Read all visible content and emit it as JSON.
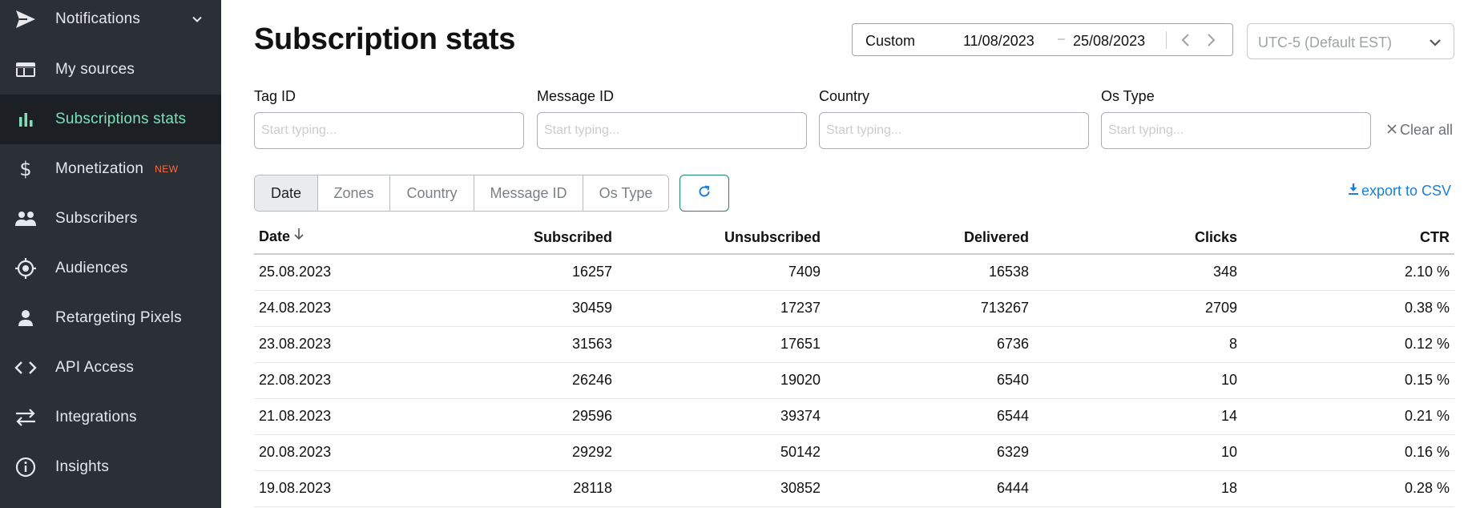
{
  "sidebar": {
    "items": [
      {
        "label": "Notifications",
        "icon": "send-icon",
        "has_chevron": true
      },
      {
        "label": "My sources",
        "icon": "sources-icon"
      },
      {
        "label": "Subscriptions stats",
        "icon": "bar-chart-icon",
        "active": true
      },
      {
        "label": "Monetization",
        "icon": "dollar-icon",
        "badge": "NEW"
      },
      {
        "label": "Subscribers",
        "icon": "people-icon"
      },
      {
        "label": "Audiences",
        "icon": "target-icon"
      },
      {
        "label": "Retargeting Pixels",
        "icon": "person-icon"
      },
      {
        "label": "API Access",
        "icon": "code-icon"
      },
      {
        "label": "Integrations",
        "icon": "swap-arrows-icon"
      },
      {
        "label": "Insights",
        "icon": "info-icon"
      }
    ]
  },
  "header": {
    "title": "Subscription stats",
    "date_range": {
      "preset": "Custom",
      "from": "11/08/2023",
      "dash": "–",
      "to": "25/08/2023"
    },
    "timezone": "UTC-5 (Default EST)"
  },
  "filters": {
    "fields": [
      {
        "label": "Tag ID",
        "placeholder": "Start typing..."
      },
      {
        "label": "Message ID",
        "placeholder": "Start typing..."
      },
      {
        "label": "Country",
        "placeholder": "Start typing..."
      },
      {
        "label": "Os Type",
        "placeholder": "Start typing..."
      }
    ],
    "clear_all": "Clear all"
  },
  "group_tabs": [
    {
      "label": "Date",
      "active": true
    },
    {
      "label": "Zones"
    },
    {
      "label": "Country"
    },
    {
      "label": "Message ID"
    },
    {
      "label": "Os Type"
    }
  ],
  "export_label": "export to CSV",
  "colors": {
    "sidebar_bg": "#2b2f36",
    "active_item_bg": "#1c1f24",
    "active_accent": "#7ee0b8",
    "badge": "#ff6a3d",
    "link": "#1a7fd6",
    "refresh_border": "#168a6a"
  },
  "table": {
    "columns": [
      "Date",
      "Subscribed",
      "Unsubscribed",
      "Delivered",
      "Clicks",
      "CTR"
    ],
    "sort": {
      "column": "Date",
      "direction": "desc"
    },
    "rows": [
      [
        "25.08.2023",
        "16257",
        "7409",
        "16538",
        "348",
        "2.10 %"
      ],
      [
        "24.08.2023",
        "30459",
        "17237",
        "713267",
        "2709",
        "0.38 %"
      ],
      [
        "23.08.2023",
        "31563",
        "17651",
        "6736",
        "8",
        "0.12 %"
      ],
      [
        "22.08.2023",
        "26246",
        "19020",
        "6540",
        "10",
        "0.15 %"
      ],
      [
        "21.08.2023",
        "29596",
        "39374",
        "6544",
        "14",
        "0.21 %"
      ],
      [
        "20.08.2023",
        "29292",
        "50142",
        "6329",
        "10",
        "0.16 %"
      ],
      [
        "19.08.2023",
        "28118",
        "30852",
        "6444",
        "18",
        "0.28 %"
      ]
    ]
  }
}
